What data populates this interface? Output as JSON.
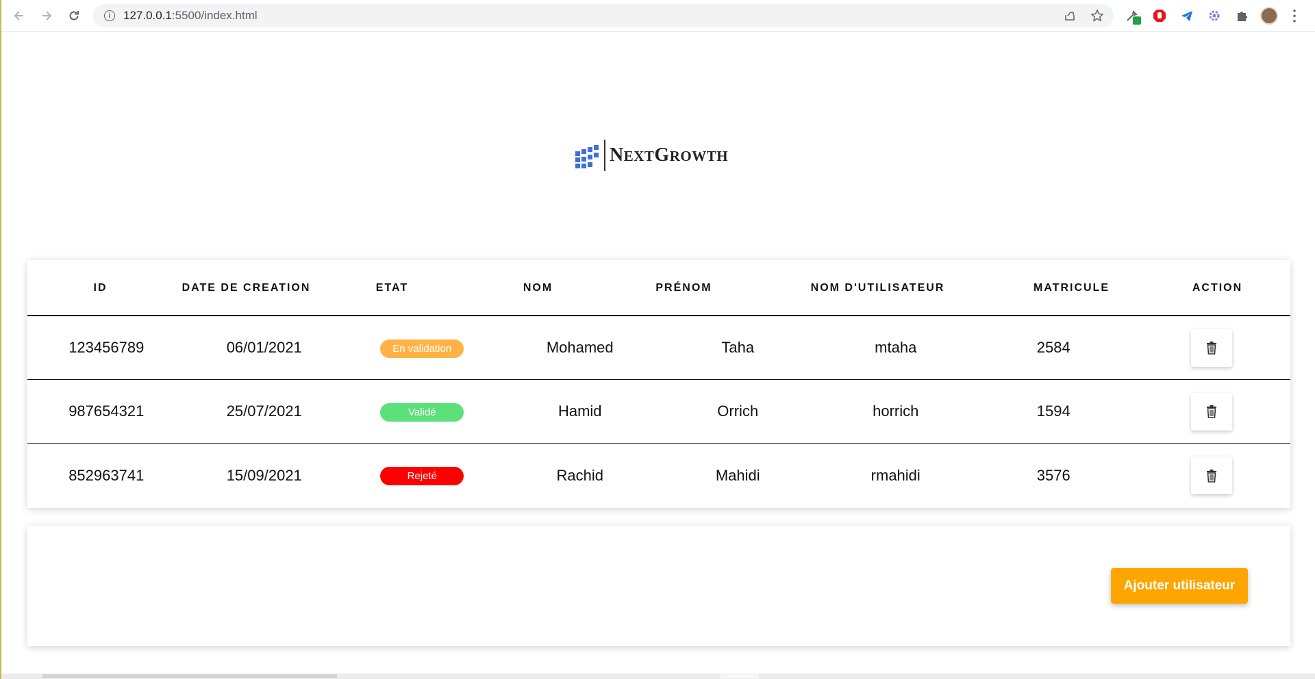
{
  "browser": {
    "url_host": "127.0.0.1",
    "url_path": ":5500/index.html",
    "icons": [
      "back-icon",
      "forward-icon",
      "reload-icon",
      "info-icon",
      "share-icon",
      "star-icon",
      "eyedropper-extension-icon",
      "adblock-extension-icon",
      "telegram-extension-icon",
      "gear-extension-icon",
      "puzzle-extensions-icon",
      "profile-avatar",
      "menu-icon"
    ]
  },
  "logo": {
    "brand_n": "N",
    "brand_ext": "EXT",
    "brand_g": "G",
    "brand_rowth": "ROWTH",
    "color": "#3f6fd8"
  },
  "table": {
    "headers": [
      "ID",
      "DATE DE CREATION",
      "ETAT",
      "NOM",
      "PRÉNOM",
      "NOM D'UTILISATEUR",
      "MATRICULE",
      "ACTION"
    ],
    "rows": [
      {
        "id": "123456789",
        "date": "06/01/2021",
        "etat": "En validation",
        "etat_color": "#ffb347",
        "nom": "Mohamed",
        "prenom": "Taha",
        "username": "mtaha",
        "matricule": "2584"
      },
      {
        "id": "987654321",
        "date": "25/07/2021",
        "etat": "Validé",
        "etat_color": "#5ce07a",
        "nom": "Hamid",
        "prenom": "Orrich",
        "username": "horrich",
        "matricule": "1594"
      },
      {
        "id": "852963741",
        "date": "15/09/2021",
        "etat": "Rejeté",
        "etat_color": "#ff0000",
        "nom": "Rachid",
        "prenom": "Mahidi",
        "username": "rmahidi",
        "matricule": "3576"
      }
    ]
  },
  "actions": {
    "add_user_label": "Ajouter utilisateur",
    "add_user_color": "#ffa500"
  }
}
